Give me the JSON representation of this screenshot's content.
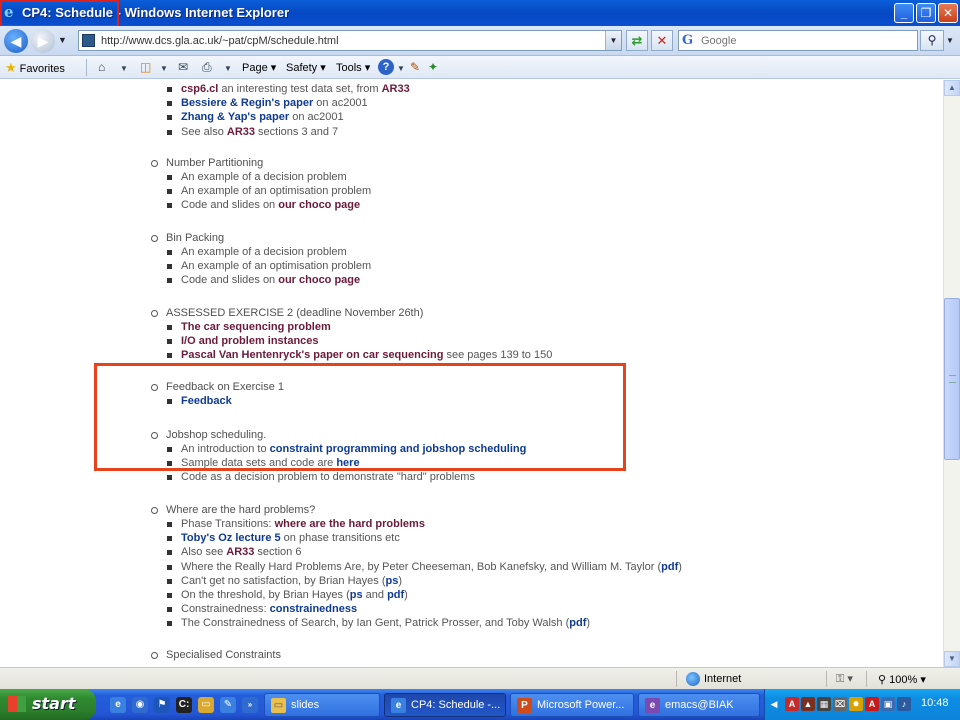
{
  "window": {
    "title": "CP4: Schedule - Windows Internet Explorer",
    "minimize": "_",
    "restore": "❐",
    "close": "✕"
  },
  "address": {
    "url": "http://www.dcs.gla.ac.uk/~pat/cpM/schedule.html",
    "search_placeholder": "Google"
  },
  "commandbar": {
    "favorites": "Favorites",
    "page": "Page",
    "safety": "Safety",
    "tools": "Tools"
  },
  "content": {
    "top_items": [
      [
        {
          "t": "csp6.cl",
          "s": "lp"
        },
        {
          "t": " an interesting test data set, from "
        },
        {
          "t": "AR33",
          "s": "lp"
        }
      ],
      [
        {
          "t": "Bessiere & Regin's paper",
          "s": "lb"
        },
        {
          "t": " on ac2001"
        }
      ],
      [
        {
          "t": "Zhang & Yap's paper",
          "s": "lb"
        },
        {
          "t": " on ac2001"
        }
      ],
      [
        {
          "t": "See also "
        },
        {
          "t": "AR33",
          "s": "lp"
        },
        {
          "t": " sections 3 and 7"
        }
      ]
    ],
    "sections": [
      {
        "title": "Number Partitioning",
        "items": [
          [
            {
              "t": "An example of a decision problem"
            }
          ],
          [
            {
              "t": "An example of an optimisation problem"
            }
          ],
          [
            {
              "t": "Code and slides on "
            },
            {
              "t": "our choco page",
              "s": "lp"
            }
          ]
        ]
      },
      {
        "title": "Bin Packing",
        "items": [
          [
            {
              "t": "An example of a decision problem"
            }
          ],
          [
            {
              "t": "An example of an optimisation problem"
            }
          ],
          [
            {
              "t": "Code and slides on "
            },
            {
              "t": "our choco page",
              "s": "lp"
            }
          ]
        ]
      },
      {
        "title": "ASSESSED EXERCISE 2 (deadline November 26th)",
        "items": [
          [
            {
              "t": "The car sequencing problem",
              "s": "lp"
            }
          ],
          [
            {
              "t": "I/O and problem instances",
              "s": "lp"
            }
          ],
          [
            {
              "t": "Pascal Van Hentenryck's paper on car sequencing",
              "s": "lp"
            },
            {
              "t": " see pages 139 to 150"
            }
          ]
        ]
      },
      {
        "title": "Feedback on Exercise 1",
        "items": [
          [
            {
              "t": "Feedback",
              "s": "lb"
            }
          ]
        ]
      },
      {
        "title": "Jobshop scheduling.",
        "items": [
          [
            {
              "t": "An introduction to "
            },
            {
              "t": "constraint programming and jobshop scheduling",
              "s": "lb"
            }
          ],
          [
            {
              "t": "Sample data sets and code are "
            },
            {
              "t": "here",
              "s": "lb"
            }
          ],
          [
            {
              "t": "Code as a decision problem to demonstrate \"hard\" problems"
            }
          ]
        ]
      },
      {
        "title": "Where are the hard problems?",
        "items": [
          [
            {
              "t": "Phase Transitions: "
            },
            {
              "t": "where are the hard problems",
              "s": "lp"
            }
          ],
          [
            {
              "t": "Toby's Oz lecture 5",
              "s": "lb"
            },
            {
              "t": " on phase transitions etc"
            }
          ],
          [
            {
              "t": "Also see "
            },
            {
              "t": "AR33",
              "s": "lp"
            },
            {
              "t": " section 6"
            }
          ],
          [
            {
              "t": "Where the Really Hard Problems Are, by Peter Cheeseman, Bob Kanefsky, and William M. Taylor ("
            },
            {
              "t": "pdf",
              "s": "lb"
            },
            {
              "t": ")"
            }
          ],
          [
            {
              "t": "Can't get no satisfaction, by Brian Hayes ("
            },
            {
              "t": "ps",
              "s": "lb"
            },
            {
              "t": ")"
            }
          ],
          [
            {
              "t": "On the threshold, by Brian Hayes ("
            },
            {
              "t": "ps",
              "s": "lb"
            },
            {
              "t": " and "
            },
            {
              "t": "pdf",
              "s": "lb"
            },
            {
              "t": ")"
            }
          ],
          [
            {
              "t": "Constrainedness: "
            },
            {
              "t": "constrainedness",
              "s": "lb"
            }
          ],
          [
            {
              "t": "The Constrainedness of Search, by Ian Gent, Patrick Prosser, and Toby Walsh ("
            },
            {
              "t": "pdf",
              "s": "lb"
            },
            {
              "t": ")"
            }
          ]
        ]
      },
      {
        "title": "Specialised Constraints",
        "items": []
      }
    ]
  },
  "status": {
    "zone": "Internet",
    "zoom": "100%"
  },
  "taskbar": {
    "start": "start",
    "tasks": [
      "slides",
      "CP4: Schedule -...",
      "Microsoft Power...",
      "emacs@BIAK"
    ],
    "clock": "10:48"
  },
  "colors": {
    "link_blue": "#0f3a94",
    "link_visited": "#6a1a3a",
    "annotation": "#e8421c"
  }
}
